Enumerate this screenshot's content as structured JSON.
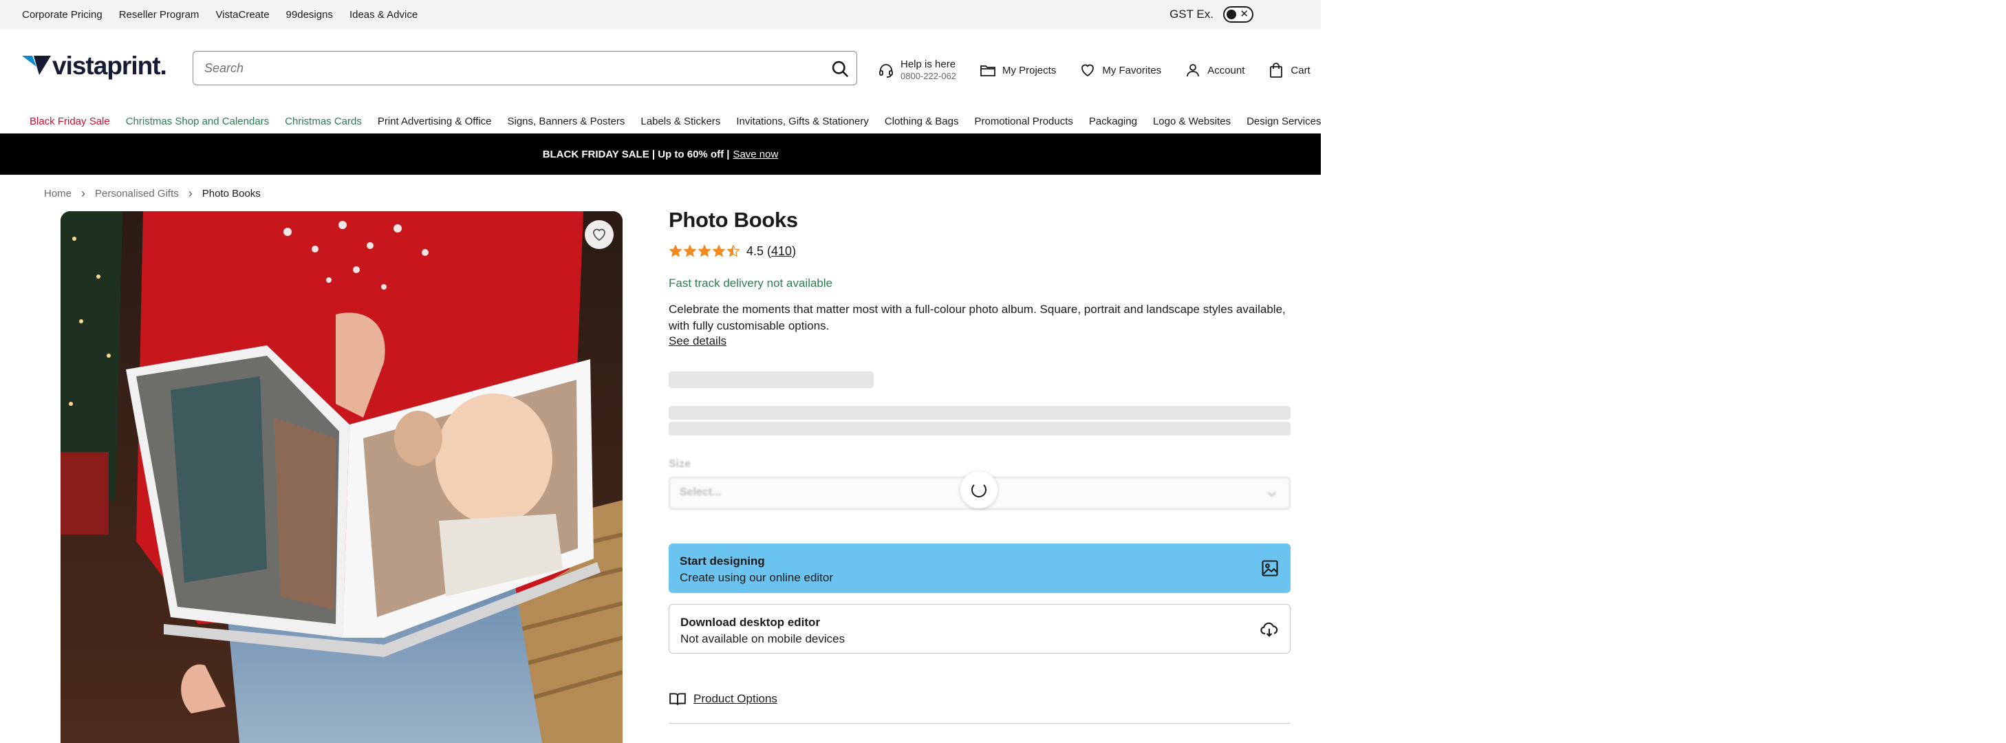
{
  "topbar": {
    "links": [
      "Corporate Pricing",
      "Reseller Program",
      "VistaCreate",
      "99designs",
      "Ideas & Advice"
    ],
    "gst_label": "GST Ex."
  },
  "header": {
    "logo_text": "vistaprint.",
    "search_placeholder": "Search",
    "help_line1": "Help is here",
    "help_line2": "0800-222-062",
    "my_projects": "My Projects",
    "my_favorites": "My Favorites",
    "account": "Account",
    "cart": "Cart"
  },
  "nav": {
    "items": [
      {
        "label": "Black Friday Sale",
        "style": "red"
      },
      {
        "label": "Christmas Shop and Calendars",
        "style": "green"
      },
      {
        "label": "Christmas Cards",
        "style": "green"
      },
      {
        "label": "Print Advertising & Office",
        "style": "normal"
      },
      {
        "label": "Signs, Banners & Posters",
        "style": "normal"
      },
      {
        "label": "Labels & Stickers",
        "style": "normal"
      },
      {
        "label": "Invitations, Gifts & Stationery",
        "style": "normal"
      },
      {
        "label": "Clothing & Bags",
        "style": "normal"
      },
      {
        "label": "Promotional Products",
        "style": "normal"
      },
      {
        "label": "Packaging",
        "style": "normal"
      },
      {
        "label": "Logo & Websites",
        "style": "normal"
      },
      {
        "label": "Design Services",
        "style": "normal"
      }
    ]
  },
  "promo": {
    "text": "BLACK FRIDAY SALE | Up to 60% off |",
    "link": "Save now"
  },
  "breadcrumb": [
    "Home",
    "Personalised Gifts",
    "Photo Books"
  ],
  "product": {
    "title": "Photo Books",
    "rating": "4.5",
    "rating_value": 4.5,
    "review_count": "410",
    "delivery": "Fast track delivery not available",
    "description": "Celebrate the moments that matter most with a full-colour photo album. Square, portrait and landscape styles available, with fully customisable options.",
    "see_details": "See details",
    "size_label": "Size",
    "size_placeholder": "Select...",
    "start_title": "Start designing",
    "start_sub": "Create using our online editor",
    "download_title": "Download desktop editor",
    "download_sub": "Not available on mobile devices",
    "options_link": "Product Options"
  },
  "colors": {
    "accent_cta": "#6bc4ef",
    "brand_navy": "#151b33",
    "sale_red": "#c8102e",
    "seasonal_green": "#2c7a50",
    "star": "#f08a24"
  }
}
